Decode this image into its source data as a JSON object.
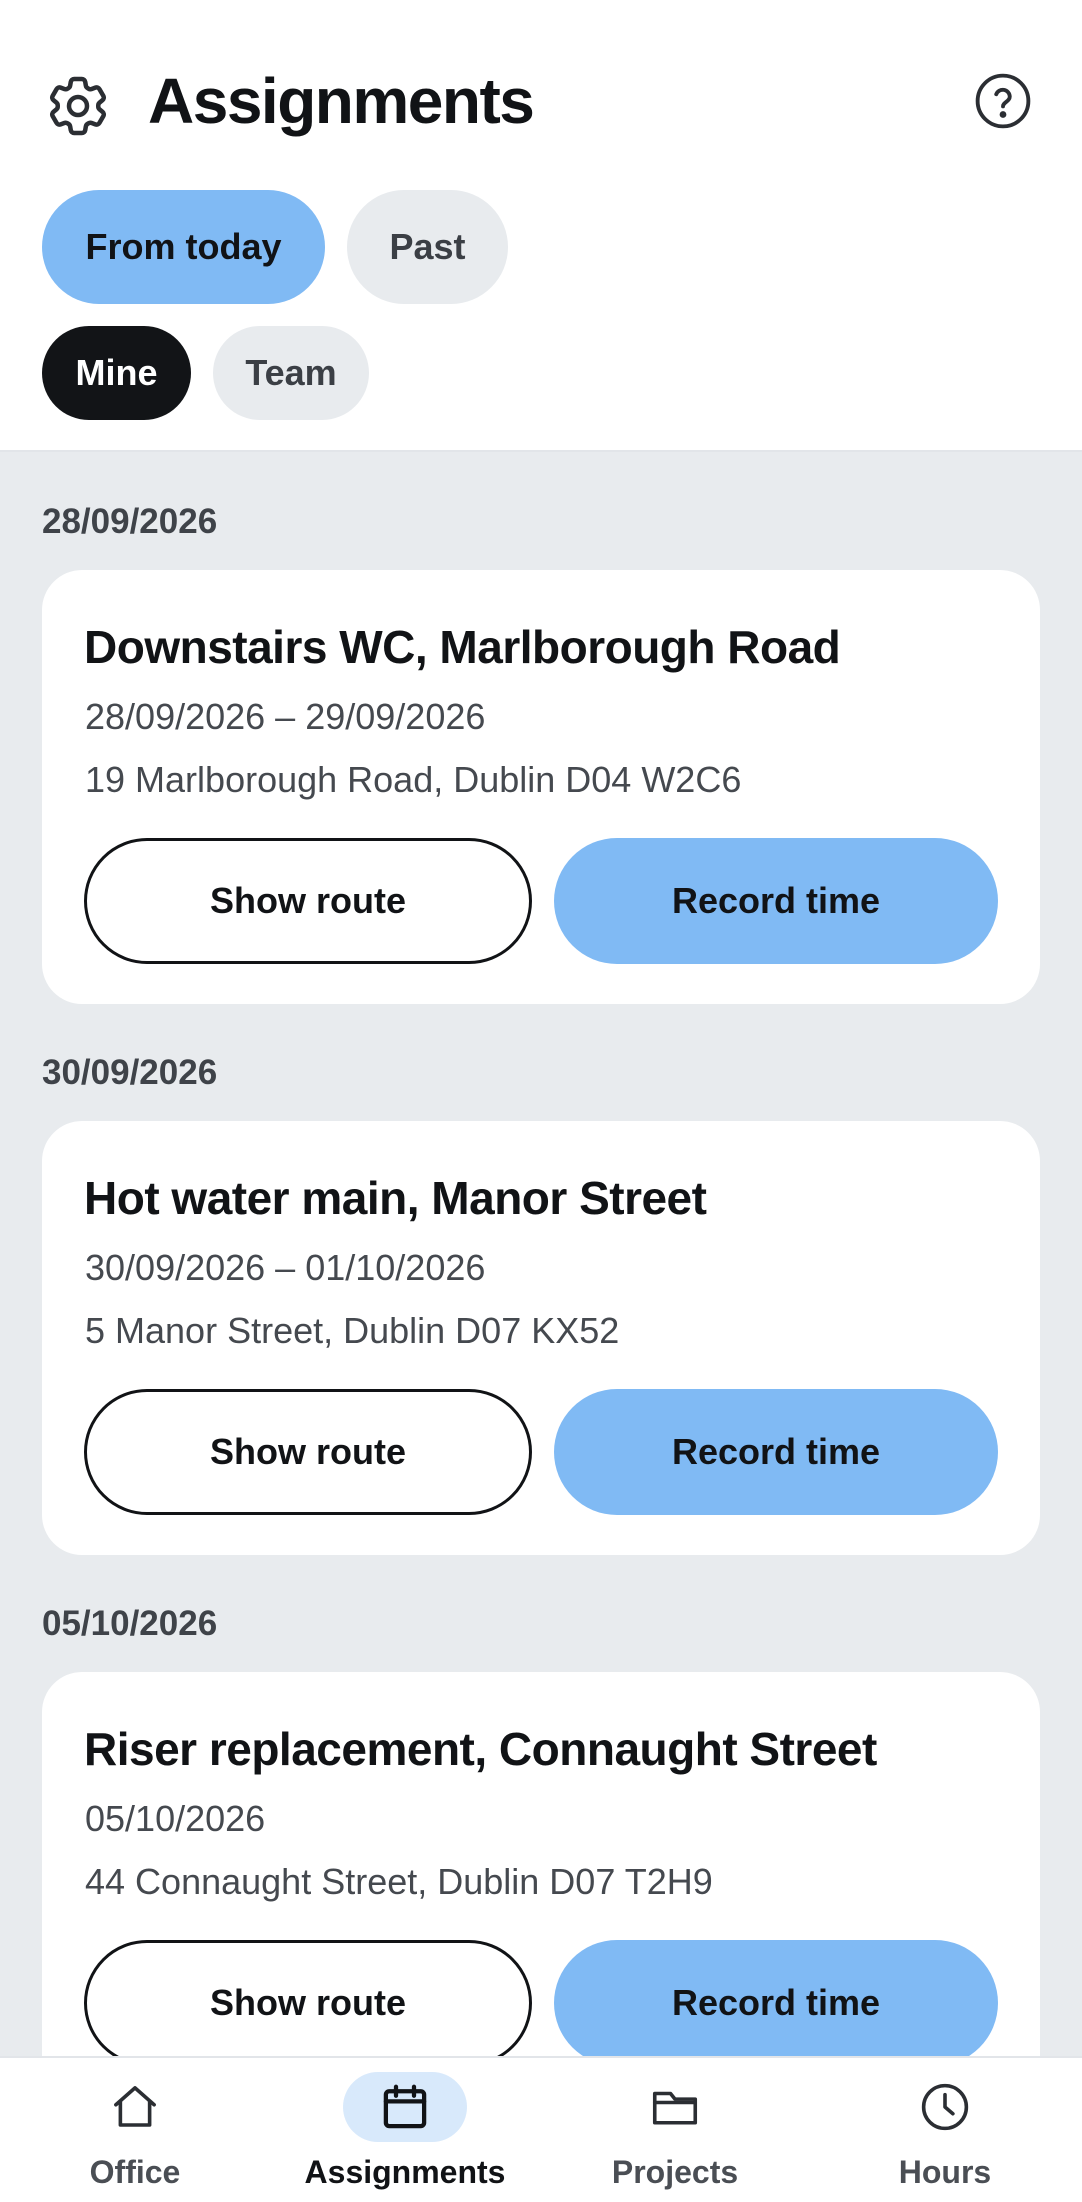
{
  "header": {
    "title": "Assignments",
    "settings_icon": "gear-icon",
    "help_icon": "help-circle-icon"
  },
  "filters": {
    "period": [
      {
        "label": "From today",
        "selected": true
      },
      {
        "label": "Past",
        "selected": false
      }
    ],
    "scope": [
      {
        "label": "Mine",
        "selected": true
      },
      {
        "label": "Team",
        "selected": false
      }
    ]
  },
  "groups": [
    {
      "date": "28/09/2026",
      "card": {
        "title": "Downstairs WC, Marlborough Road",
        "dates": "28/09/2026 – 29/09/2026",
        "address": "19 Marlborough Road, Dublin D04 W2C6",
        "route_label": "Show route",
        "record_label": "Record time"
      }
    },
    {
      "date": "30/09/2026",
      "card": {
        "title": "Hot water main, Manor Street",
        "dates": "30/09/2026 – 01/10/2026",
        "address": "5 Manor Street, Dublin D07 KX52",
        "route_label": "Show route",
        "record_label": "Record time"
      }
    },
    {
      "date": "05/10/2026",
      "card": {
        "title": "Riser replacement, Connaught Street",
        "dates": "05/10/2026",
        "address": "44 Connaught Street, Dublin D07 T2H9",
        "route_label": "Show route",
        "record_label": "Record time"
      }
    }
  ],
  "tabbar": {
    "items": [
      {
        "label": "Office",
        "icon": "home-icon",
        "active": false
      },
      {
        "label": "Assignments",
        "icon": "calendar-icon",
        "active": true
      },
      {
        "label": "Projects",
        "icon": "folder-icon",
        "active": false
      },
      {
        "label": "Hours",
        "icon": "clock-icon",
        "active": false
      }
    ]
  },
  "colors": {
    "accent": "#80baf4",
    "accent_soft": "#d8e9fb",
    "dark_chip": "#121417",
    "list_background": "#e8ebee"
  }
}
